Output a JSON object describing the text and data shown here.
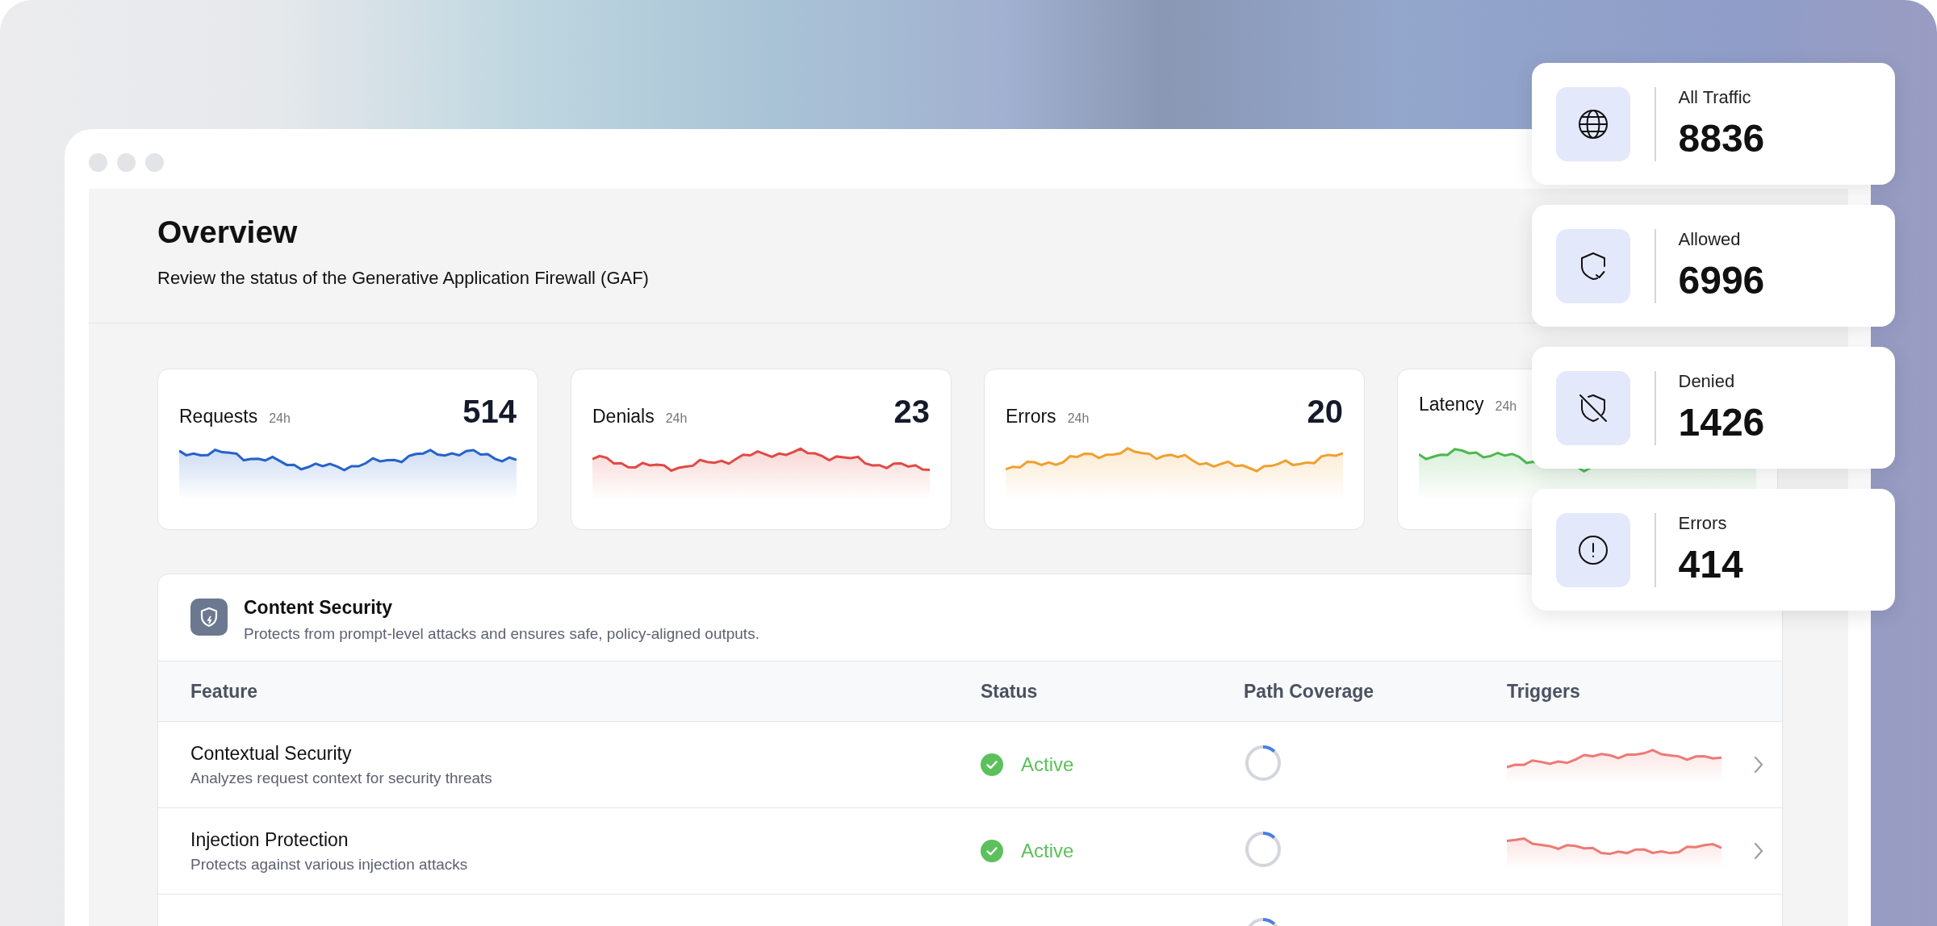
{
  "page": {
    "title": "Overview",
    "subtitle": "Review the status of the Generative Application Firewall (GAF)"
  },
  "metrics": [
    {
      "label": "Requests",
      "period": "24h",
      "value": "514",
      "color": "#2563c9"
    },
    {
      "label": "Denials",
      "period": "24h",
      "value": "23",
      "color": "#e04a45"
    },
    {
      "label": "Errors",
      "period": "24h",
      "value": "20",
      "color": "#efa02f"
    },
    {
      "label": "Latency",
      "period": "24h",
      "color": "#4cb84f"
    }
  ],
  "content_security": {
    "title": "Content Security",
    "description": "Protects from prompt-level attacks and ensures safe, policy-aligned outputs.",
    "columns": [
      "Feature",
      "Status",
      "Path Coverage",
      "Triggers"
    ],
    "rows": [
      {
        "feature": "Contextual Security",
        "description": "Analyzes request context for security threats",
        "status": "Active",
        "level": 0.12
      },
      {
        "feature": "Injection Protection",
        "description": "Protects against various injection attacks",
        "status": "Active",
        "level": 0.12
      },
      {
        "level": 0.12
      }
    ]
  },
  "traffic_cards": [
    {
      "kind": "globe",
      "label": "All Traffic",
      "value": "8836"
    },
    {
      "kind": "shield-check",
      "label": "Allowed",
      "value": "6996"
    },
    {
      "kind": "shield-off",
      "label": "Denied",
      "value": "1426"
    },
    {
      "kind": "alert",
      "label": "Errors",
      "value": "414"
    }
  ]
}
